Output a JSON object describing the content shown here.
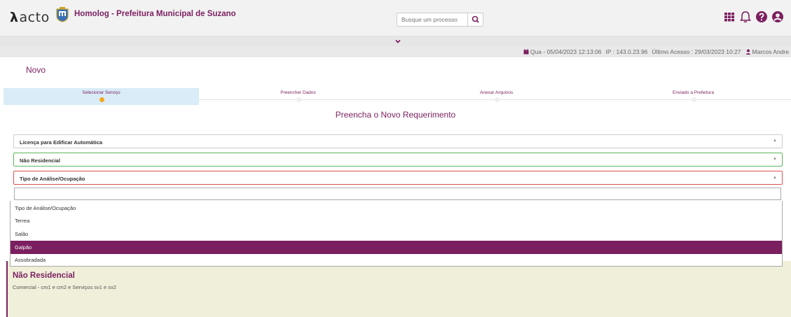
{
  "header": {
    "logo_text": "acto",
    "logo_mark": "λ",
    "app_title": "Homolog - Prefeitura Municipal de Suzano",
    "search_placeholder": "Busque um processo",
    "icons": [
      "grid-icon",
      "bell-icon",
      "help-icon",
      "user-icon"
    ]
  },
  "infobar": {
    "date": "Qua - 05/04/2023 12:13:06",
    "ip": "IP : 143.0.23.96",
    "last_access": "Último Acesso : 29/03/2023 10:27",
    "user": "Marcos Andre"
  },
  "page": {
    "title": "Novo",
    "subtitle": "Preencha o Novo Requerimento"
  },
  "steps": [
    {
      "label": "Selecionar Serviço",
      "active": true
    },
    {
      "label": "Preencher Dados",
      "active": false
    },
    {
      "label": "Anexar Arquivos",
      "active": false
    },
    {
      "label": "Enviado a Prefeitura",
      "active": false
    }
  ],
  "form": {
    "service": "Licença para Edificar Automática",
    "category": "Não Residencial",
    "analysis_type": "Tipo de Análise/Ocupação",
    "filter_value": "",
    "options": [
      "Tipo de Análise/Ocupação",
      "Terrea",
      "Salão",
      "Galpão",
      "Assobradada"
    ],
    "highlighted_option": "Galpão"
  },
  "info_panel": {
    "heading": "Não Residencial",
    "text": "Comercial - cm1 e cm2 e Serviços sv1 e sv2"
  },
  "colors": {
    "brand": "#7b1f60",
    "accent": "#f5a623",
    "valid": "#5cb85c",
    "invalid": "#d9534f"
  }
}
